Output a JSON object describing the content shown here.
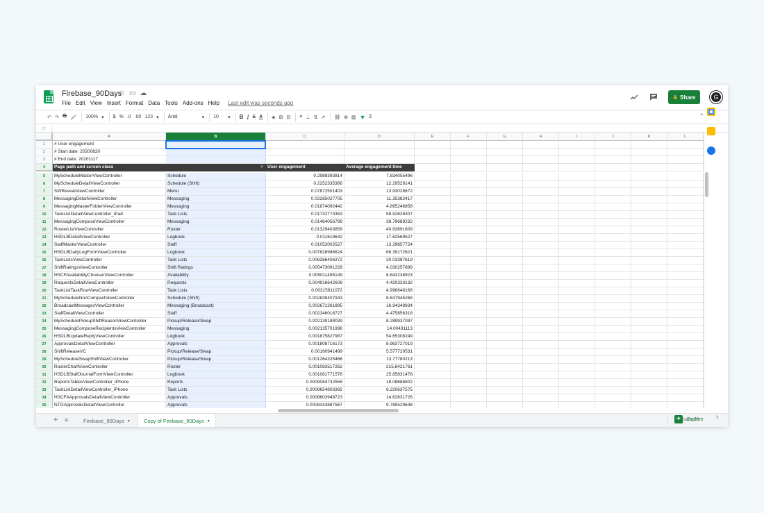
{
  "app": {
    "title": "Firebase_90Days",
    "title_icons": [
      "☆",
      "▭",
      "☁"
    ],
    "menu": [
      "File",
      "Edit",
      "View",
      "Insert",
      "Format",
      "Data",
      "Tools",
      "Add-ons",
      "Help"
    ],
    "last_edit": "Last edit was seconds ago",
    "share_label": "Share",
    "share_icon": "🔒",
    "avatar_letter": "G"
  },
  "toolbar": {
    "items": [
      "↶",
      "↷",
      "🖶",
      "🖌",
      "100%",
      "▾",
      "$",
      "%",
      ".0",
      ".00",
      "123",
      "▾",
      "Arial",
      "▾",
      "10",
      "▾",
      "B",
      "I",
      "S",
      "A",
      "◈",
      "⊞",
      "⊟",
      "≡",
      "⊥",
      "⇅",
      "↗",
      "⛓",
      "⊕",
      "▥",
      "▼",
      "Σ"
    ],
    "zoom": "100%",
    "font": "Arial",
    "font_size": "10",
    "bold": "B",
    "italic": "I",
    "strike": "S",
    "text_color": "A",
    "filter_icon": "▼",
    "sum": "Σ",
    "format_num": "123",
    "currency": "$",
    "percent": "%",
    "dec_less": ".0",
    "dec_more": ".00"
  },
  "formula_bar": {
    "fx": "fx",
    "value": ""
  },
  "columns": [
    "A",
    "B",
    "C",
    "D",
    "E",
    "F",
    "G",
    "H",
    "I",
    "J",
    "K",
    "L"
  ],
  "meta_rows": [
    {
      "row": "1",
      "text": "# User engagement"
    },
    {
      "row": "2",
      "text": "# Start date: 20200820"
    },
    {
      "row": "3",
      "text": "# End date: 20201117"
    }
  ],
  "header_row": {
    "row": "4",
    "a": "Page path and screen class",
    "b": "",
    "c": "User engagement",
    "d": "Average engagement time"
  },
  "rows": [
    {
      "row": "5",
      "a": "MyScheduleMasterViewController",
      "b": "Schedule",
      "c": "0.2988393814",
      "d": "7.834055496"
    },
    {
      "row": "6",
      "a": "MyScheduleDetailViewController",
      "b": "Schedule (Shift)",
      "c": "0.2252335366",
      "d": "12.29529141"
    },
    {
      "row": "7",
      "a": "SWRevealViewController",
      "b": "Menu",
      "c": "0.07872501403",
      "d": "13.93028672"
    },
    {
      "row": "8",
      "a": "MessagingDetailViewController",
      "b": "Messaging",
      "c": "0.02285027705",
      "d": "11.35382417"
    },
    {
      "row": "9",
      "a": "MessagingMasterFolderViewController",
      "b": "Messaging",
      "c": "0.01874092442",
      "d": "4.895246858"
    },
    {
      "row": "10",
      "a": "TaskListDetailViewController_iPad",
      "b": "Task Lists",
      "c": "0.01732773353",
      "d": "58.92626307"
    },
    {
      "row": "11",
      "a": "MessagingComposeViewController",
      "b": "Messaging",
      "c": "0.01464056799",
      "d": "38.79689232"
    },
    {
      "row": "12",
      "a": "RosterListViewController",
      "b": "Roster",
      "c": "0.01329403859",
      "d": "40.93891609"
    },
    {
      "row": "13",
      "a": "HSDLBDetailViewController",
      "b": "Logbook",
      "c": "0.011619642",
      "d": "17.62569527"
    },
    {
      "row": "14",
      "a": "StaffMasterViewController",
      "b": "Staff",
      "c": "0.01052002527",
      "d": "13.29857724"
    },
    {
      "row": "15",
      "a": "HSDLBDailyLogFormViewController",
      "b": "Logbook",
      "c": "0.007828986624",
      "d": "68.39172621"
    },
    {
      "row": "16",
      "a": "TaskListsViewController",
      "b": "Task Lists",
      "c": "0.006266406372",
      "d": "30.03387619"
    },
    {
      "row": "17",
      "a": "ShiftRatingsViewController",
      "b": "Shift Ratings",
      "c": "0.005473091228",
      "d": "4.030257899"
    },
    {
      "row": "18",
      "a": "HSCFAvailabilityChooserViewController",
      "b": "Availability",
      "c": "0.005011495149",
      "d": "8.843238923"
    },
    {
      "row": "19",
      "a": "RequestsDetailViewController",
      "b": "Requests",
      "c": "0.004916642608",
      "d": "4.420333132"
    },
    {
      "row": "20",
      "a": "TaskListTaskRowViewController",
      "b": "Task Lists",
      "c": "0.00315911072",
      "d": "4.996648168"
    },
    {
      "row": "21",
      "a": "MyScheduleNonCompactViewController",
      "b": "Schedule (Shift)",
      "c": "0.002839407943",
      "d": "8.637945269"
    },
    {
      "row": "22",
      "a": "BroadcastMessagesViewController",
      "b": "Messaging (Broadcast)",
      "c": "0.002671261895",
      "d": "16.94348934"
    },
    {
      "row": "23",
      "a": "StaffDetailViewController",
      "b": "Staff",
      "c": "0.002346016727",
      "d": "4.475856318"
    },
    {
      "row": "24",
      "a": "MySchedulePickupShiftReasonViewController",
      "b": "Pickup/Release/Swap",
      "c": "0.002139189039",
      "d": "8.289937097"
    },
    {
      "row": "25",
      "a": "MessagingComposeRecipientsViewController",
      "b": "Messaging",
      "c": "0.002135701998",
      "d": "14.00431113"
    },
    {
      "row": "26",
      "a": "HSDLBUpdateReplyViewController",
      "b": "Logbook",
      "c": "0.001875827987",
      "d": "54.65308249"
    },
    {
      "row": "27",
      "a": "ApprovalsDetailViewController",
      "b": "Approvals",
      "c": "0.001808716173",
      "d": "8.963727019"
    },
    {
      "row": "28",
      "a": "ShiftReleaseVC",
      "b": "Pickup/Release/Swap",
      "c": "0.00160941499",
      "d": "5.577729531"
    },
    {
      "row": "29",
      "a": "MyScheduleSwapShiftViewController",
      "b": "Pickup/Release/Swap",
      "c": "0.001264325466",
      "d": "13.77780213"
    },
    {
      "row": "30",
      "a": "RosterChartViewController",
      "b": "Roster",
      "c": "0.001083517262",
      "d": "215.8421761"
    },
    {
      "row": "31",
      "a": "HSDLBStaffJournalFormViewController",
      "b": "Logbook",
      "c": "0.001081771576",
      "d": "25.85831478"
    },
    {
      "row": "32",
      "a": "ReportsTablesViewController_iPhone",
      "b": "Reports",
      "c": "0.0009084732558",
      "d": "18.08686802"
    },
    {
      "row": "33",
      "a": "TaskListDetailViewController_iPhone",
      "b": "Task Lists",
      "c": "0.0008654803392",
      "d": "6.220637575"
    },
    {
      "row": "34",
      "a": "HSCFAApprovalsDetailViewController",
      "b": "Approvals",
      "c": "0.0008603949723",
      "d": "14.62831726"
    },
    {
      "row": "35",
      "a": "NTOApprovalsDetailViewController",
      "b": "Approvals",
      "c": "0.0008343887567",
      "d": "9.785529648"
    }
  ],
  "sheets": [
    {
      "label": "Firebase_90Days",
      "active": false
    },
    {
      "label": "Copy of Firebase_90Days",
      "active": true
    }
  ],
  "status": {
    "count": "Count: 95",
    "explore": "Explore"
  },
  "sheet_controls": {
    "add": "+",
    "list": "≡",
    "caret": "▾"
  }
}
